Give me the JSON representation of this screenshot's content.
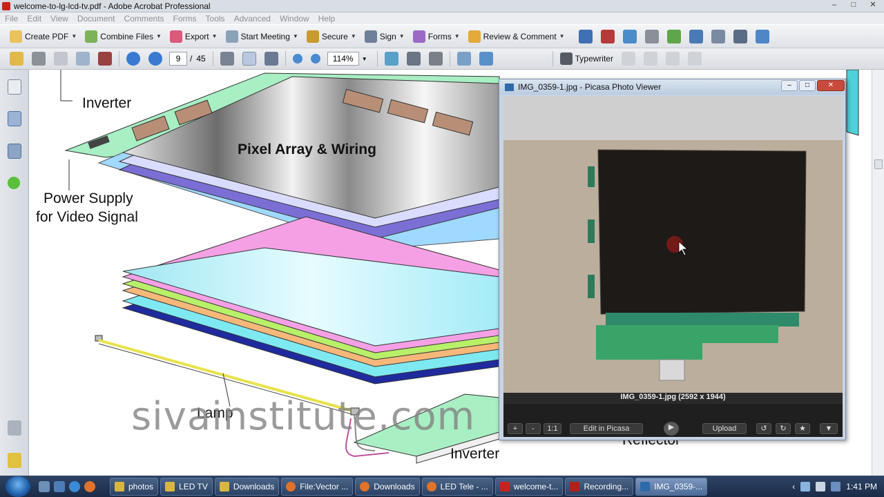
{
  "window": {
    "title": "welcome-to-lg-lcd-tv.pdf - Adobe Acrobat Professional",
    "controls": [
      "–",
      "□",
      "✕"
    ]
  },
  "menu": [
    "File",
    "Edit",
    "View",
    "Document",
    "Comments",
    "Forms",
    "Tools",
    "Advanced",
    "Window",
    "Help"
  ],
  "toolbar1": {
    "create_pdf": "Create PDF",
    "combine_files": "Combine Files",
    "export": "Export",
    "start_meeting": "Start Meeting",
    "secure": "Secure",
    "sign": "Sign",
    "forms": "Forms",
    "review_comment": "Review & Comment"
  },
  "toolbar2": {
    "current_page": "9",
    "page_separator": "/",
    "total_pages": "45",
    "zoom": "114%",
    "typewriter": "Typewriter"
  },
  "diagram": {
    "labels": {
      "inverter_top": "Inverter",
      "pixel_array": "Pixel Array & Wiring",
      "power_supply_1": "Power Supply",
      "power_supply_2": "for Video Signal",
      "lamp": "Lamp",
      "inverter_bottom": "Inverter",
      "reflector": "Reflector"
    },
    "watermark": "sivainstitute.com"
  },
  "picasa": {
    "title": "IMG_0359-1.jpg - Picasa Photo Viewer",
    "caption": "IMG_0359-1.jpg (2592 x 1944)",
    "buttons": {
      "zoom_in": "+",
      "zoom_out": "-",
      "actual_size": "1:1",
      "edit": "Edit in Picasa",
      "upload": "Upload"
    }
  },
  "taskbar": {
    "items": [
      {
        "label": "photos",
        "color": "#d9b640"
      },
      {
        "label": "LED TV",
        "color": "#d9b640"
      },
      {
        "label": "Downloads",
        "color": "#d9b640"
      },
      {
        "label": "File:Vector ...",
        "color": "#e0722a"
      },
      {
        "label": "Downloads",
        "color": "#e0722a"
      },
      {
        "label": "LED Tele - ...",
        "color": "#e0722a"
      },
      {
        "label": "welcome-t...",
        "color": "#c8221d"
      },
      {
        "label": "Recording...",
        "color": "#b3201c"
      },
      {
        "label": "IMG_0359-...",
        "color": "#2f6aa8"
      }
    ],
    "clock": "1:41 PM"
  }
}
